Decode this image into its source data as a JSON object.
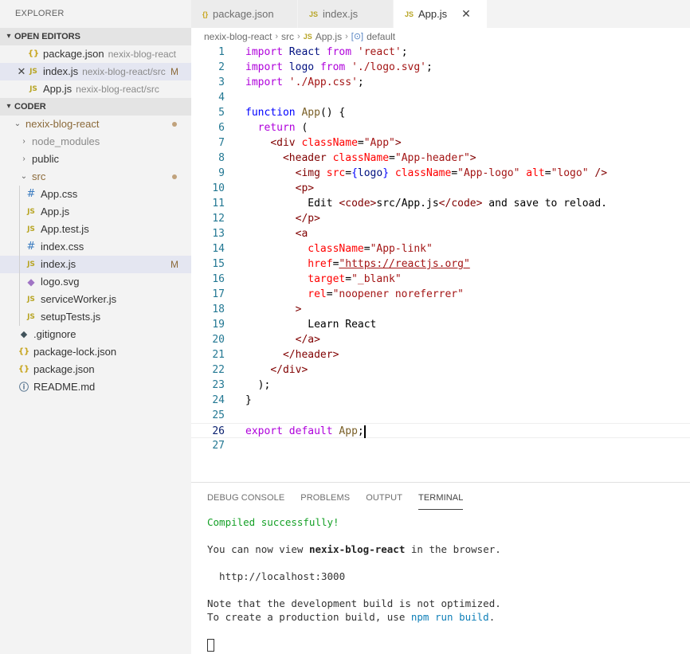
{
  "explorer": {
    "title": "EXPLORER",
    "open_editors_label": "OPEN EDITORS",
    "open_editors": [
      {
        "close": "",
        "icon": "{}",
        "name": "package.json",
        "desc": "nexix-blog-react",
        "mod": ""
      },
      {
        "close": "✕",
        "icon": "JS",
        "name": "index.js",
        "desc": "nexix-blog-react/src",
        "mod": "M"
      },
      {
        "close": "",
        "icon": "JS",
        "name": "App.js",
        "desc": "nexix-blog-react/src",
        "mod": ""
      }
    ],
    "workspace_label": "CODER",
    "tree": {
      "project": "nexix-blog-react",
      "node_modules": "node_modules",
      "public": "public",
      "src": "src",
      "src_files": [
        {
          "icon": "#",
          "name": "App.css"
        },
        {
          "icon": "JS",
          "name": "App.js"
        },
        {
          "icon": "JS",
          "name": "App.test.js"
        },
        {
          "icon": "#",
          "name": "index.css"
        },
        {
          "icon": "JS",
          "name": "index.js",
          "mod": "M"
        },
        {
          "icon": "◆",
          "name": "logo.svg"
        },
        {
          "icon": "JS",
          "name": "serviceWorker.js"
        },
        {
          "icon": "JS",
          "name": "setupTests.js"
        }
      ],
      "root_files": [
        {
          "icon": "◆",
          "name": ".gitignore"
        },
        {
          "icon": "{}",
          "name": "package-lock.json"
        },
        {
          "icon": "{}",
          "name": "package.json"
        },
        {
          "icon": "ⓘ",
          "name": "README.md"
        }
      ]
    }
  },
  "tabs": [
    {
      "icon": "{}",
      "label": "package.json"
    },
    {
      "icon": "JS",
      "label": "index.js"
    },
    {
      "icon": "JS",
      "label": "App.js",
      "close": "✕"
    }
  ],
  "breadcrumb": {
    "project": "nexix-blog-react",
    "folder": "src",
    "file_icon": "JS",
    "file": "App.js",
    "symbol_icon": "[⊙]",
    "symbol": "default",
    "sep": "›"
  },
  "code": [
    {
      "n": "1",
      "indent": "",
      "tokens": [
        [
          "kw-ctl",
          "import"
        ],
        [
          "txt",
          " "
        ],
        [
          "var",
          "React"
        ],
        [
          "txt",
          " "
        ],
        [
          "ctl",
          "from"
        ],
        [
          "txt",
          " "
        ],
        [
          "str",
          "'react'"
        ],
        [
          "txt",
          ";"
        ]
      ]
    },
    {
      "n": "2",
      "indent": "",
      "tokens": [
        [
          "ctl",
          "import"
        ],
        [
          "txt",
          " "
        ],
        [
          "var",
          "logo"
        ],
        [
          "txt",
          " "
        ],
        [
          "ctl",
          "from"
        ],
        [
          "txt",
          " "
        ],
        [
          "str",
          "'./logo.svg'"
        ],
        [
          "txt",
          ";"
        ]
      ]
    },
    {
      "n": "3",
      "indent": "",
      "tokens": [
        [
          "ctl",
          "import"
        ],
        [
          "txt",
          " "
        ],
        [
          "str",
          "'./App.css'"
        ],
        [
          "txt",
          ";"
        ]
      ]
    },
    {
      "n": "4",
      "indent": "",
      "tokens": []
    },
    {
      "n": "5",
      "indent": "",
      "tokens": [
        [
          "kw",
          "function"
        ],
        [
          "txt",
          " "
        ],
        [
          "fn",
          "App"
        ],
        [
          "txt",
          "() {"
        ]
      ]
    },
    {
      "n": "6",
      "indent": "  ",
      "tokens": [
        [
          "ctl",
          "return"
        ],
        [
          "txt",
          " ("
        ]
      ]
    },
    {
      "n": "7",
      "indent": "    ",
      "tokens": [
        [
          "tag",
          "<div"
        ],
        [
          "txt",
          " "
        ],
        [
          "attr",
          "className"
        ],
        [
          "txt",
          "="
        ],
        [
          "str",
          "\"App\""
        ],
        [
          "tag",
          ">"
        ]
      ]
    },
    {
      "n": "8",
      "indent": "      ",
      "tokens": [
        [
          "tag",
          "<header"
        ],
        [
          "txt",
          " "
        ],
        [
          "attr",
          "className"
        ],
        [
          "txt",
          "="
        ],
        [
          "str",
          "\"App-header\""
        ],
        [
          "tag",
          ">"
        ]
      ]
    },
    {
      "n": "9",
      "indent": "        ",
      "tokens": [
        [
          "tag",
          "<img"
        ],
        [
          "txt",
          " "
        ],
        [
          "attr",
          "src"
        ],
        [
          "txt",
          "="
        ],
        [
          "kw",
          "{"
        ],
        [
          "var",
          "logo"
        ],
        [
          "kw",
          "}"
        ],
        [
          "txt",
          " "
        ],
        [
          "attr",
          "className"
        ],
        [
          "txt",
          "="
        ],
        [
          "str",
          "\"App-logo\""
        ],
        [
          "txt",
          " "
        ],
        [
          "attr",
          "alt"
        ],
        [
          "txt",
          "="
        ],
        [
          "str",
          "\"logo\""
        ],
        [
          "txt",
          " "
        ],
        [
          "tag",
          "/>"
        ]
      ]
    },
    {
      "n": "10",
      "indent": "        ",
      "tokens": [
        [
          "tag",
          "<p>"
        ]
      ]
    },
    {
      "n": "11",
      "indent": "          ",
      "tokens": [
        [
          "txt",
          "Edit "
        ],
        [
          "tag",
          "<code>"
        ],
        [
          "txt",
          "src/App.js"
        ],
        [
          "tag",
          "</code>"
        ],
        [
          "txt",
          " and save to reload."
        ]
      ]
    },
    {
      "n": "12",
      "indent": "        ",
      "tokens": [
        [
          "tag",
          "</p>"
        ]
      ]
    },
    {
      "n": "13",
      "indent": "        ",
      "tokens": [
        [
          "tag",
          "<a"
        ]
      ]
    },
    {
      "n": "14",
      "indent": "          ",
      "tokens": [
        [
          "attr",
          "className"
        ],
        [
          "txt",
          "="
        ],
        [
          "str",
          "\"App-link\""
        ]
      ]
    },
    {
      "n": "15",
      "indent": "          ",
      "tokens": [
        [
          "attr",
          "href"
        ],
        [
          "txt",
          "="
        ],
        [
          "link",
          "\"https://reactjs.org\""
        ]
      ]
    },
    {
      "n": "16",
      "indent": "          ",
      "tokens": [
        [
          "attr",
          "target"
        ],
        [
          "txt",
          "="
        ],
        [
          "str",
          "\"_blank\""
        ]
      ]
    },
    {
      "n": "17",
      "indent": "          ",
      "tokens": [
        [
          "attr",
          "rel"
        ],
        [
          "txt",
          "="
        ],
        [
          "str",
          "\"noopener noreferrer\""
        ]
      ]
    },
    {
      "n": "18",
      "indent": "        ",
      "tokens": [
        [
          "tag",
          ">"
        ]
      ]
    },
    {
      "n": "19",
      "indent": "          ",
      "tokens": [
        [
          "txt",
          "Learn React"
        ]
      ]
    },
    {
      "n": "20",
      "indent": "        ",
      "tokens": [
        [
          "tag",
          "</a>"
        ]
      ]
    },
    {
      "n": "21",
      "indent": "      ",
      "tokens": [
        [
          "tag",
          "</header>"
        ]
      ]
    },
    {
      "n": "22",
      "indent": "    ",
      "tokens": [
        [
          "tag",
          "</div>"
        ]
      ]
    },
    {
      "n": "23",
      "indent": "  ",
      "tokens": [
        [
          "txt",
          ");"
        ]
      ]
    },
    {
      "n": "24",
      "indent": "",
      "tokens": [
        [
          "txt",
          "}"
        ]
      ]
    },
    {
      "n": "25",
      "indent": "",
      "tokens": []
    },
    {
      "n": "26",
      "indent": "",
      "tokens": [
        [
          "ctl",
          "export"
        ],
        [
          "txt",
          " "
        ],
        [
          "ctl",
          "default"
        ],
        [
          "txt",
          " "
        ],
        [
          "fn",
          "App"
        ],
        [
          "txt",
          ";"
        ]
      ],
      "current": true
    },
    {
      "n": "27",
      "indent": "",
      "tokens": []
    }
  ],
  "panel": {
    "tabs": [
      "DEBUG CONSOLE",
      "PROBLEMS",
      "OUTPUT",
      "TERMINAL"
    ],
    "active_tab": "TERMINAL",
    "terminal": {
      "compiled": "Compiled successfully!",
      "view_prefix": "You can now view ",
      "view_app": "nexix-blog-react",
      "view_suffix": " in the browser.",
      "url": "  http://localhost:3000",
      "note1": "Note that the development build is not optimized.",
      "note2_prefix": "To create a production build, use ",
      "note2_cmd": "npm run build",
      "note2_suffix": "."
    }
  }
}
